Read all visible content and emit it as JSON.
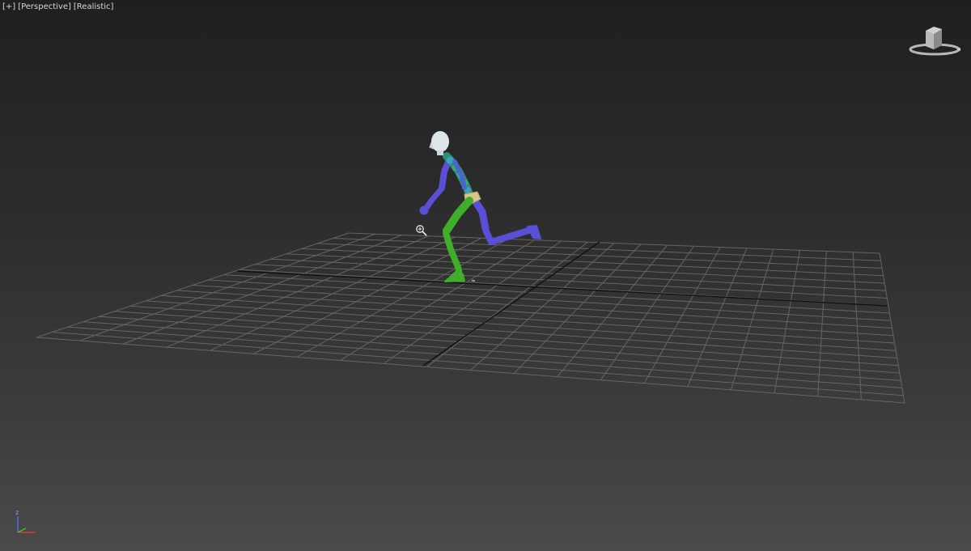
{
  "viewport": {
    "labels": {
      "plus": "[+]",
      "view": "[Perspective]",
      "shading": "[Realistic]"
    },
    "colors": {
      "bg_top": "#1f1f1f",
      "bg_bottom": "#4a4a4a",
      "grid": "#6e6e6e",
      "grid_axis": "#111111",
      "skeleton_left": "#5a4fd6",
      "skeleton_right": "#3fae2a",
      "spine": "#2f8f6a",
      "head": "#dfe6ea",
      "pelvis": "#d9c48a"
    },
    "icons": {
      "viewcube": "viewcube-icon",
      "axis": "axis-tripod-icon",
      "cursor": "zoom-cursor-icon"
    },
    "axis": {
      "z_label": "z"
    }
  }
}
